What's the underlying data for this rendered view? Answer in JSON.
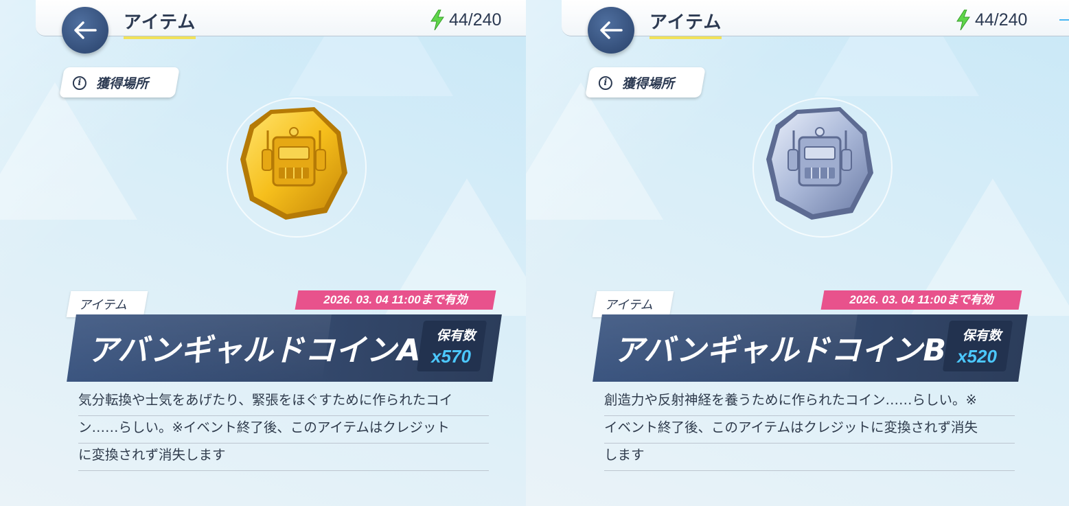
{
  "panels": [
    {
      "header": {
        "title": "アイテム",
        "stamina": "44/240"
      },
      "source_button": {
        "label": "獲得場所"
      },
      "item": {
        "type_tag": "アイテム",
        "expiry": "2026. 03. 04 11:00まで有効",
        "name": "アバンギャルドコインA",
        "count_label": "保有数",
        "count_value": "x570",
        "coin_color": "gold",
        "description_lines": [
          "気分転換や士気をあげたり、緊張をほぐすために作られたコイ",
          "ン……らしい。※イベント終了後、このアイテムはクレジット",
          "に変換されず消失します"
        ]
      }
    },
    {
      "header": {
        "title": "アイテム",
        "stamina": "44/240"
      },
      "source_button": {
        "label": "獲得場所"
      },
      "item": {
        "type_tag": "アイテム",
        "expiry": "2026. 03. 04 11:00まで有効",
        "name": "アバンギャルドコインB",
        "count_label": "保有数",
        "count_value": "x520",
        "coin_color": "silver",
        "description_lines": [
          "創造力や反射神経を養うために作られたコイン……らしい。※",
          "イベント終了後、このアイテムはクレジットに変換されず消失",
          "します"
        ]
      }
    }
  ],
  "colors": {
    "accent_pink": "#e8528c",
    "count_blue": "#4cc8ff",
    "navy": "#34496d",
    "stamina_green": "#5fd64a",
    "title_underline": "#f1e25a"
  }
}
